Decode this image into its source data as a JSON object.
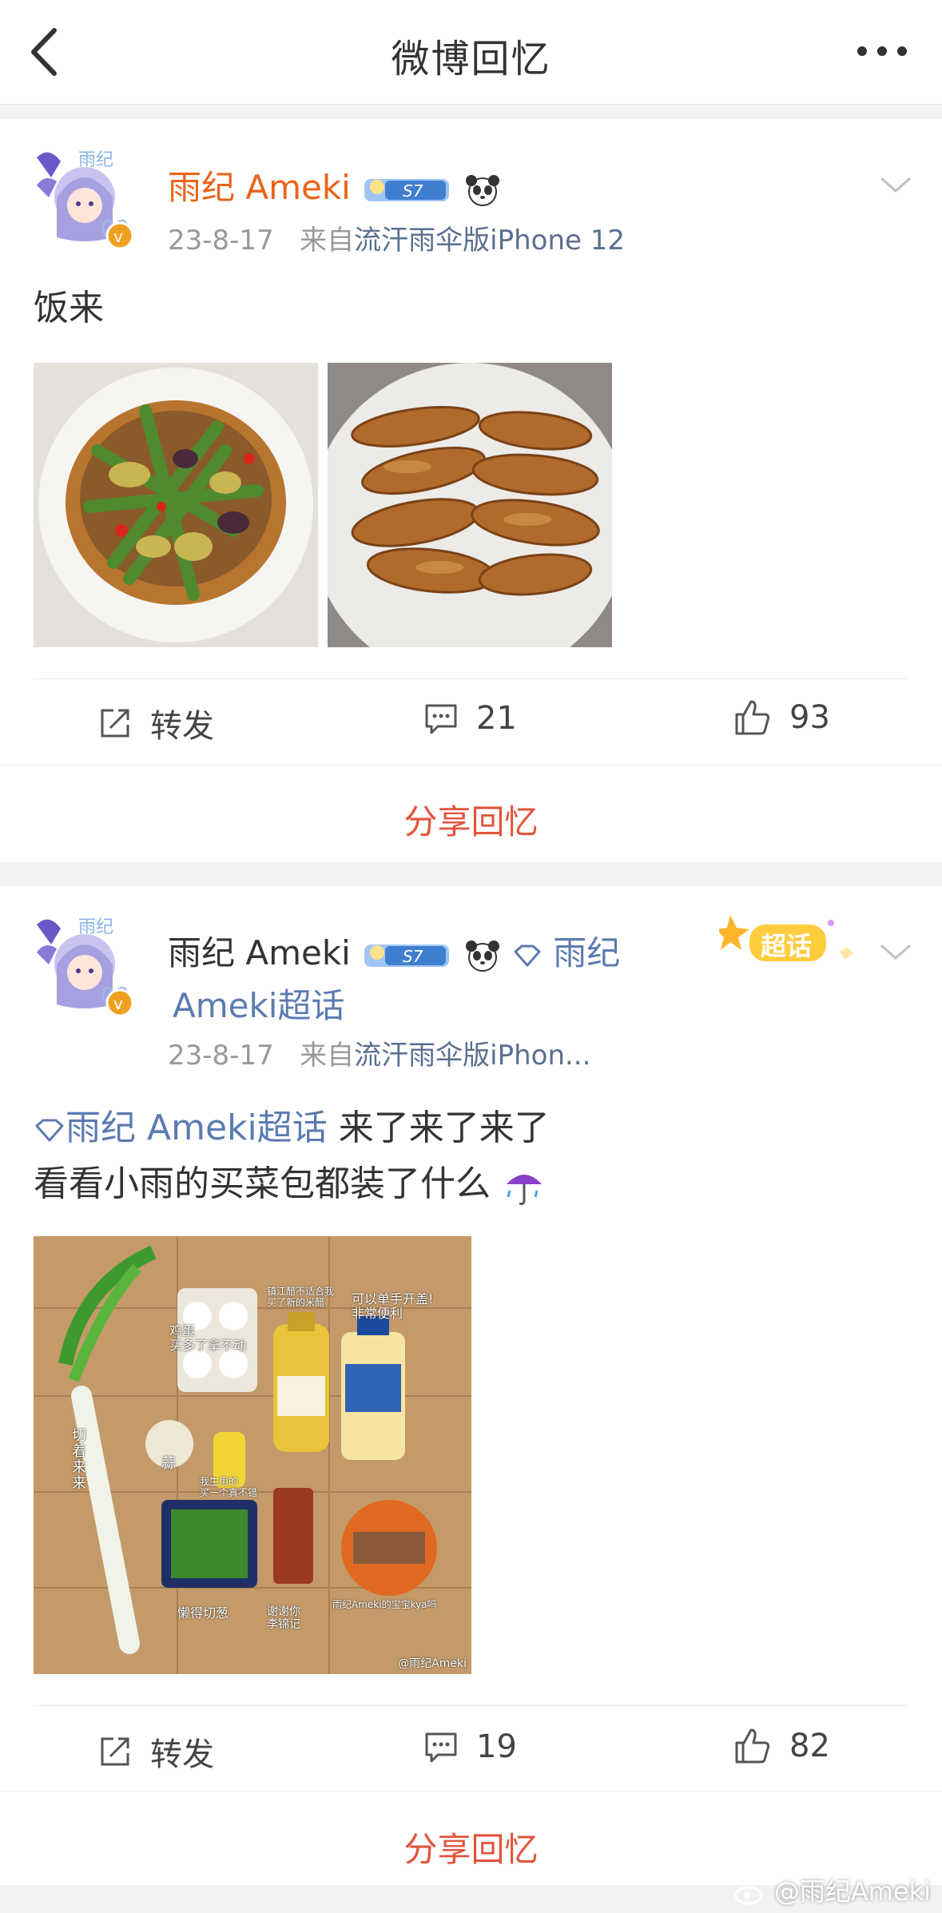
{
  "nav": {
    "title": "微博回忆"
  },
  "posts": [
    {
      "user": "雨纪 Ameki",
      "level_badge": "S7",
      "time": "23-8-17",
      "source_prefix": "来自",
      "source": "流汗雨伞版iPhone 12",
      "text": "饭来",
      "actions": {
        "repost": "转发",
        "comments": "21",
        "likes": "93"
      },
      "share": "分享回忆"
    },
    {
      "user": "雨纪 Ameki",
      "level_badge": "S7",
      "topic_inline": "雨纪",
      "topic_line2": "Ameki超话",
      "time": "23-8-17",
      "source_prefix": "来自",
      "source": "流汗雨伞版iPhon...",
      "super_badge": "超话",
      "text_topic": "雨纪 Ameki超话",
      "text_line1": " 来了来了来了",
      "text_line2": "看看小雨的买菜包都装了什么",
      "photo_labels": {
        "eggs": "鸡蛋\n买多了拿不动",
        "vinegar": "镇江醋不适合我\n买了新的米醋",
        "oil": "可以单手开盖!\n非常便利",
        "scallion": "切着来来",
        "garlic": "蒜",
        "lemon": "我生用的\n买一个真不错",
        "chives": "懒得切葱",
        "paste": "谢谢你\n李锦记",
        "noodle": "雨纪Ameki的宝宝kya吗"
      },
      "photo_watermark": "@雨纪Ameki",
      "actions": {
        "repost": "转发",
        "comments": "19",
        "likes": "82"
      },
      "share": "分享回忆"
    }
  ],
  "footer_watermark": "@雨纪Ameki"
}
